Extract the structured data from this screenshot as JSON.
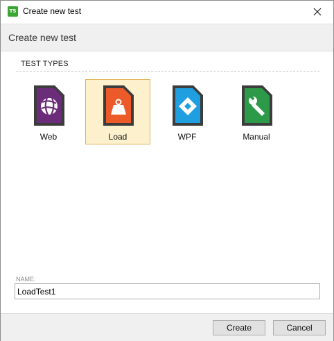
{
  "window": {
    "title": "Create new test",
    "app_icon_text": "TS",
    "accent_color": "#3aa635"
  },
  "header": {
    "title": "Create new test"
  },
  "test_types": {
    "section_label": "TEST TYPES",
    "selected": "Load",
    "items": [
      {
        "label": "Web",
        "icon": "web-globe-icon",
        "color": "#6b2c7a"
      },
      {
        "label": "Load",
        "icon": "load-weight-icon",
        "color": "#ec5a2a"
      },
      {
        "label": "WPF",
        "icon": "wpf-diamond-icon",
        "color": "#1f9ee0"
      },
      {
        "label": "Manual",
        "icon": "manual-wrench-icon",
        "color": "#2d9a4a"
      }
    ]
  },
  "name_field": {
    "label": "NAME:",
    "value": "LoadTest1"
  },
  "footer": {
    "create_label": "Create",
    "cancel_label": "Cancel"
  }
}
